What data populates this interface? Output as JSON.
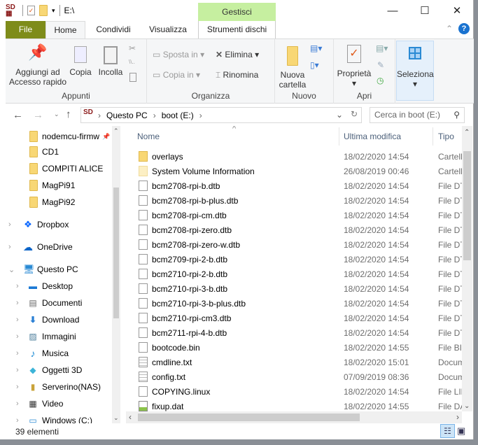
{
  "window": {
    "title": "E:\\",
    "context_tab": "Gestisci",
    "controls": {
      "minimize": "—",
      "maximize": "☐",
      "close": "✕"
    }
  },
  "tabs": [
    "File",
    "Home",
    "Condividi",
    "Visualizza",
    "Strumenti dischi"
  ],
  "ribbon": {
    "appunti": {
      "label": "Appunti",
      "pin": "Aggiungi ad Accesso rapido",
      "copy": "Copia",
      "paste": "Incolla"
    },
    "organizza": {
      "label": "Organizza",
      "move": "Sposta in",
      "copyto": "Copia in",
      "delete": "Elimina",
      "rename": "Rinomina"
    },
    "nuovo": {
      "label": "Nuovo",
      "newfolder": "Nuova cartella"
    },
    "apri": {
      "label": "Apri",
      "properties": "Proprietà"
    },
    "select": {
      "label": "Seleziona"
    }
  },
  "address": {
    "crumbs": [
      "Questo PC",
      "boot (E:)"
    ],
    "search_placeholder": "Cerca in boot (E:)"
  },
  "nav": {
    "items": [
      {
        "label": "nodemcu-firmw",
        "icon": "folder-icon",
        "indent": 1,
        "pinned": true
      },
      {
        "label": "CD1",
        "icon": "folder-icon",
        "indent": 1
      },
      {
        "label": "COMPITI ALICE",
        "icon": "folder-icon",
        "indent": 1
      },
      {
        "label": "MagPi91",
        "icon": "folder-icon",
        "indent": 1
      },
      {
        "label": "MagPi92",
        "icon": "folder-icon",
        "indent": 1
      },
      {
        "label": "Dropbox",
        "icon": "dropbox-icon",
        "indent": 0,
        "expander": "›"
      },
      {
        "label": "OneDrive",
        "icon": "cloud-icon",
        "indent": 0,
        "expander": "›"
      },
      {
        "label": "Questo PC",
        "icon": "computer-icon",
        "indent": 0,
        "expander": "⌄"
      },
      {
        "label": "Desktop",
        "icon": "desktop-icon",
        "indent": 1,
        "expander": "›"
      },
      {
        "label": "Documenti",
        "icon": "document-icon",
        "indent": 1,
        "expander": "›"
      },
      {
        "label": "Download",
        "icon": "download-icon",
        "indent": 1,
        "expander": "›"
      },
      {
        "label": "Immagini",
        "icon": "image-icon",
        "indent": 1,
        "expander": "›"
      },
      {
        "label": "Musica",
        "icon": "music-icon",
        "indent": 1,
        "expander": "›"
      },
      {
        "label": "Oggetti 3D",
        "icon": "cube-icon",
        "indent": 1,
        "expander": "›"
      },
      {
        "label": "Serverino(NAS)",
        "icon": "network-drive-icon",
        "indent": 1,
        "expander": "›"
      },
      {
        "label": "Video",
        "icon": "video-icon",
        "indent": 1,
        "expander": "›"
      },
      {
        "label": "Windows (C:)",
        "icon": "drive-icon",
        "indent": 1,
        "expander": "›"
      }
    ]
  },
  "columns": {
    "name": "Nome",
    "modified": "Ultima modifica",
    "type": "Tipo"
  },
  "files": [
    {
      "name": "overlays",
      "date": "18/02/2020 14:54",
      "type": "Cartella",
      "icon": "folder"
    },
    {
      "name": "System Volume Information",
      "date": "26/08/2019 00:46",
      "type": "Cartella",
      "icon": "folder-hidden"
    },
    {
      "name": "bcm2708-rpi-b.dtb",
      "date": "18/02/2020 14:54",
      "type": "File DTB",
      "icon": "file"
    },
    {
      "name": "bcm2708-rpi-b-plus.dtb",
      "date": "18/02/2020 14:54",
      "type": "File DTB",
      "icon": "file"
    },
    {
      "name": "bcm2708-rpi-cm.dtb",
      "date": "18/02/2020 14:54",
      "type": "File DTB",
      "icon": "file"
    },
    {
      "name": "bcm2708-rpi-zero.dtb",
      "date": "18/02/2020 14:54",
      "type": "File DTB",
      "icon": "file"
    },
    {
      "name": "bcm2708-rpi-zero-w.dtb",
      "date": "18/02/2020 14:54",
      "type": "File DTB",
      "icon": "file"
    },
    {
      "name": "bcm2709-rpi-2-b.dtb",
      "date": "18/02/2020 14:54",
      "type": "File DTB",
      "icon": "file"
    },
    {
      "name": "bcm2710-rpi-2-b.dtb",
      "date": "18/02/2020 14:54",
      "type": "File DTB",
      "icon": "file"
    },
    {
      "name": "bcm2710-rpi-3-b.dtb",
      "date": "18/02/2020 14:54",
      "type": "File DTB",
      "icon": "file"
    },
    {
      "name": "bcm2710-rpi-3-b-plus.dtb",
      "date": "18/02/2020 14:54",
      "type": "File DTB",
      "icon": "file"
    },
    {
      "name": "bcm2710-rpi-cm3.dtb",
      "date": "18/02/2020 14:54",
      "type": "File DTB",
      "icon": "file"
    },
    {
      "name": "bcm2711-rpi-4-b.dtb",
      "date": "18/02/2020 14:54",
      "type": "File DTB",
      "icon": "file"
    },
    {
      "name": "bootcode.bin",
      "date": "18/02/2020 14:55",
      "type": "File BIN",
      "icon": "file"
    },
    {
      "name": "cmdline.txt",
      "date": "18/02/2020 15:01",
      "type": "Documento",
      "icon": "text"
    },
    {
      "name": "config.txt",
      "date": "07/09/2019 08:36",
      "type": "Documento",
      "icon": "text"
    },
    {
      "name": "COPYING.linux",
      "date": "18/02/2020 14:54",
      "type": "File LINUX",
      "icon": "file"
    },
    {
      "name": "fixup.dat",
      "date": "18/02/2020 14:55",
      "type": "File DAT",
      "icon": "dat"
    }
  ],
  "status": {
    "count": "39 elementi"
  },
  "colors": {
    "file_tab": "#7e8c1a",
    "context_tab": "#c6efa0",
    "folder": "#f8d775",
    "header_text": "#4c607a"
  }
}
